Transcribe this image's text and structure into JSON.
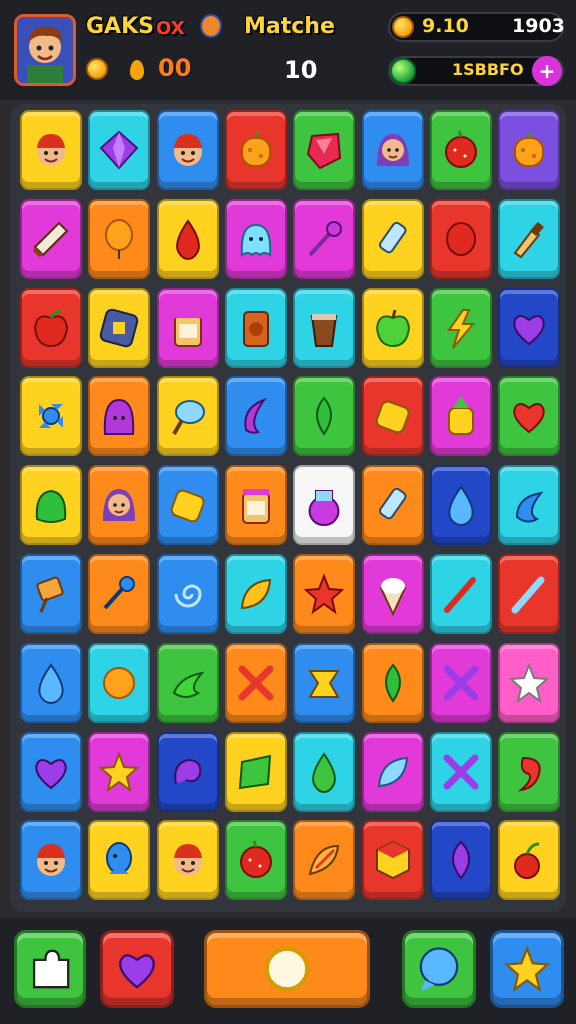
{
  "header": {
    "title_left": "GAKS",
    "title_mid": "OX",
    "title_right": "Matche",
    "coins_value": "00",
    "level_value": "10",
    "stat_top_left": "9.10",
    "stat_top_right": "1903",
    "stat_bottom": "1SBBFO",
    "plus_label": "+",
    "avatar_icon": "boy-avatar-icon"
  },
  "colors": {
    "red": "#e8362c",
    "blue": "#2f8df0",
    "green": "#3fc43f",
    "yellow": "#ffd21f",
    "orange": "#ff8a1c",
    "magenta": "#e23ad8",
    "cyan": "#2ed3e6",
    "purple": "#7b4fe0",
    "navy": "#2247c7",
    "pink": "#ff5ec8",
    "white": "#f6f6f6",
    "lime": "#7be23a"
  },
  "grid": [
    [
      {
        "bg": "yellow",
        "icon": "boy-face-icon"
      },
      {
        "bg": "cyan",
        "icon": "purple-gem-icon"
      },
      {
        "bg": "blue",
        "icon": "boy-face-icon"
      },
      {
        "bg": "red",
        "icon": "orange-fruit-icon"
      },
      {
        "bg": "green",
        "icon": "red-gem-icon"
      },
      {
        "bg": "blue",
        "icon": "girl-face-icon"
      },
      {
        "bg": "green",
        "icon": "red-berry-icon"
      },
      {
        "bg": "purple",
        "icon": "orange-fruit-icon"
      }
    ],
    [
      {
        "bg": "magenta",
        "icon": "candy-bar-icon"
      },
      {
        "bg": "orange",
        "icon": "orange-balloon-icon"
      },
      {
        "bg": "yellow",
        "icon": "red-drop-icon"
      },
      {
        "bg": "magenta",
        "icon": "blue-ghost-icon"
      },
      {
        "bg": "magenta",
        "icon": "purple-wand-icon"
      },
      {
        "bg": "yellow",
        "icon": "bottle-icon"
      },
      {
        "bg": "red",
        "icon": "red-bean-icon"
      },
      {
        "bg": "cyan",
        "icon": "brush-icon"
      }
    ],
    [
      {
        "bg": "red",
        "icon": "red-apple-icon"
      },
      {
        "bg": "yellow",
        "icon": "box-icon"
      },
      {
        "bg": "magenta",
        "icon": "jar-icon"
      },
      {
        "bg": "cyan",
        "icon": "can-icon"
      },
      {
        "bg": "cyan",
        "icon": "cup-icon"
      },
      {
        "bg": "yellow",
        "icon": "green-apple-icon"
      },
      {
        "bg": "green",
        "icon": "lightning-icon"
      },
      {
        "bg": "navy",
        "icon": "purple-heart-icon"
      }
    ],
    [
      {
        "bg": "yellow",
        "icon": "blue-candy-icon"
      },
      {
        "bg": "orange",
        "icon": "purple-hood-icon"
      },
      {
        "bg": "yellow",
        "icon": "ice-cream-icon"
      },
      {
        "bg": "blue",
        "icon": "purple-moon-icon"
      },
      {
        "bg": "green",
        "icon": "green-leaf-icon"
      },
      {
        "bg": "red",
        "icon": "yellow-block-icon"
      },
      {
        "bg": "magenta",
        "icon": "pineapple-icon"
      },
      {
        "bg": "green",
        "icon": "red-heart-icon"
      }
    ],
    [
      {
        "bg": "yellow",
        "icon": "green-slime-icon"
      },
      {
        "bg": "orange",
        "icon": "girl-face-icon"
      },
      {
        "bg": "blue",
        "icon": "yellow-block-icon"
      },
      {
        "bg": "orange",
        "icon": "jar-icon"
      },
      {
        "bg": "white",
        "icon": "potion-icon"
      },
      {
        "bg": "orange",
        "icon": "bottle-icon"
      },
      {
        "bg": "navy",
        "icon": "blue-drop-icon"
      },
      {
        "bg": "cyan",
        "icon": "blue-moon-icon"
      }
    ],
    [
      {
        "bg": "blue",
        "icon": "lollipop-icon"
      },
      {
        "bg": "orange",
        "icon": "blue-key-icon"
      },
      {
        "bg": "blue",
        "icon": "swirl-icon"
      },
      {
        "bg": "cyan",
        "icon": "yellow-leaf-icon"
      },
      {
        "bg": "orange",
        "icon": "red-star-icon"
      },
      {
        "bg": "magenta",
        "icon": "cone-icon"
      },
      {
        "bg": "cyan",
        "icon": "red-pen-icon"
      },
      {
        "bg": "red",
        "icon": "blue-pen-icon"
      }
    ],
    [
      {
        "bg": "blue",
        "icon": "blue-drop-icon"
      },
      {
        "bg": "cyan",
        "icon": "orange-ball-icon"
      },
      {
        "bg": "green",
        "icon": "green-moon-icon"
      },
      {
        "bg": "orange",
        "icon": "red-x-icon"
      },
      {
        "bg": "blue",
        "icon": "yellow-bow-icon"
      },
      {
        "bg": "orange",
        "icon": "green-leaf-icon"
      },
      {
        "bg": "magenta",
        "icon": "purple-x-icon"
      },
      {
        "bg": "pink",
        "icon": "white-star-icon"
      }
    ],
    [
      {
        "bg": "blue",
        "icon": "purple-heart-icon"
      },
      {
        "bg": "magenta",
        "icon": "yellow-star-icon"
      },
      {
        "bg": "navy",
        "icon": "purple-swirl-icon"
      },
      {
        "bg": "yellow",
        "icon": "green-block-icon"
      },
      {
        "bg": "cyan",
        "icon": "green-drop-icon"
      },
      {
        "bg": "magenta",
        "icon": "blue-leaf-icon"
      },
      {
        "bg": "cyan",
        "icon": "purple-x-icon"
      },
      {
        "bg": "green",
        "icon": "red-comma-icon"
      }
    ],
    [
      {
        "bg": "blue",
        "icon": "boy-face-icon"
      },
      {
        "bg": "yellow",
        "icon": "blue-fish-icon"
      },
      {
        "bg": "yellow",
        "icon": "boy-face-icon"
      },
      {
        "bg": "green",
        "icon": "red-berry-icon"
      },
      {
        "bg": "orange",
        "icon": "shell-icon"
      },
      {
        "bg": "red",
        "icon": "cube-icon"
      },
      {
        "bg": "navy",
        "icon": "purple-leaf-icon"
      },
      {
        "bg": "yellow",
        "icon": "red-cherry-icon"
      }
    ]
  ],
  "bottom_buttons": [
    {
      "name": "left-button",
      "bg": "green",
      "icon": "puzzle-icon"
    },
    {
      "name": "booster-button",
      "bg": "red",
      "icon": "purple-heart-icon"
    },
    {
      "name": "play-button",
      "bg": "orange",
      "icon": "white-circle-icon"
    },
    {
      "name": "chat-button",
      "bg": "green",
      "icon": "blue-bubble-icon"
    },
    {
      "name": "star-button",
      "bg": "blue",
      "icon": "yellow-star-icon"
    }
  ]
}
